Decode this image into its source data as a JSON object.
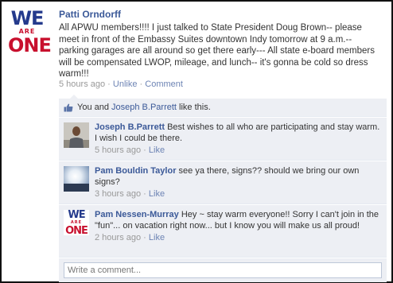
{
  "post": {
    "author": "Patti Orndorff",
    "text": "All APWU members!!!! I just talked to State President Doug Brown-- please meet in front of the Embassy Suites downtown Indy tomorrow at 9 a.m.-- parking garages are all around so get there early--- All state e-board members will be compensated LWOP, mileage, and lunch-- it's gonna be cold so dress warm!!!",
    "time": "5 hours ago",
    "unlike_label": "Unlike",
    "comment_label": "Comment",
    "logo": {
      "line1": "WE",
      "line2": "ARE",
      "line3": "ONE"
    }
  },
  "likes": {
    "prefix": "You and ",
    "liker": "Joseph B.Parrett",
    "suffix": " like this.",
    "icon": "thumbs-up-icon"
  },
  "comments": [
    {
      "author": "Joseph B.Parrett",
      "text": "Best wishes to all who are participating and stay warm. I wish I could be there.",
      "time": "5 hours ago",
      "like_label": "Like",
      "avatar": "person-photo"
    },
    {
      "author": "Pam Bouldin Taylor",
      "text": "see ya there, signs?? should we bring our own signs?",
      "time": "3 hours ago",
      "like_label": "Like",
      "avatar": "sunset-photo"
    },
    {
      "author": "Pam Nessen-Murray",
      "text": "Hey ~ stay warm everyone!! Sorry I can't join in the \"fun\"... on vacation right now... but I know you will make us all proud!",
      "time": "2 hours ago",
      "like_label": "Like",
      "avatar": "we-are-one-logo",
      "logo": {
        "line1": "WE",
        "line2": "ARE",
        "line3": "ONE"
      }
    }
  ],
  "comment_box": {
    "placeholder": "Write a comment..."
  },
  "separator": "·",
  "colors": {
    "link": "#3b5998",
    "panel": "#edeff4",
    "logo_blue": "#243a8c",
    "logo_red": "#c8102e"
  }
}
